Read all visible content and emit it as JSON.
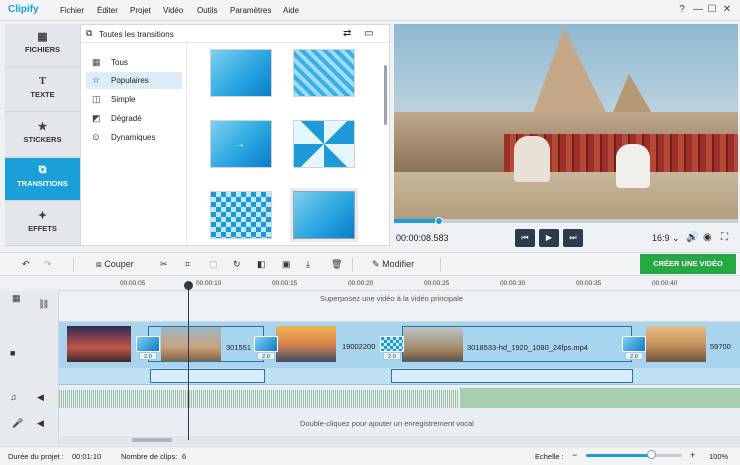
{
  "app": {
    "logo": "Clipify"
  },
  "menu": [
    "Fichier",
    "Éditer",
    "Projet",
    "Vidéo",
    "Outils",
    "Paramètres",
    "Aide"
  ],
  "window_icons": [
    "?",
    "—",
    "☐",
    "✕"
  ],
  "left_tabs": [
    {
      "label": "FICHIERS",
      "icon": "film-icon"
    },
    {
      "label": "TEXTE",
      "icon": "text-icon"
    },
    {
      "label": "STICKERS",
      "icon": "star-icon"
    },
    {
      "label": "TRANSITIONS",
      "icon": "transitions-icon"
    },
    {
      "label": "EFFETS",
      "icon": "wand-icon"
    }
  ],
  "transitions": {
    "title": "Toutes les transitions",
    "categories": [
      {
        "label": "Tous",
        "icon": "grid-icon"
      },
      {
        "label": "Populaires",
        "icon": "star-icon"
      },
      {
        "label": "Simple",
        "icon": "simple-icon"
      },
      {
        "label": "Dégradé",
        "icon": "gradient-icon"
      },
      {
        "label": "Dynamiques",
        "icon": "play-icon"
      }
    ],
    "selected_category": "Populaires"
  },
  "preview": {
    "timecode": "00:00:08.583",
    "progress": 0.13,
    "ratio": "16:9"
  },
  "toolbar": {
    "cut_label": "Couper",
    "edit_label": "Modifier",
    "create_label": "CRÉER UNE VIDÉO"
  },
  "ruler": [
    "00:00:05",
    "00:00:10",
    "00:00:15",
    "00:00:20",
    "00:00:25",
    "00:00:30",
    "00:00:35",
    "00:00:40"
  ],
  "tracks": {
    "overlay_hint": "Superposez une vidéo à la vidéo principale",
    "voice_hint": "Double-cliquez pour ajouter un enregistrement vocal",
    "clips": [
      {
        "label": "",
        "dur": ""
      },
      {
        "label": "301551",
        "dur": "2.0"
      },
      {
        "label": "19002200",
        "dur": "2.0"
      },
      {
        "label": "3018533-hd_1920_1080_24fps.mp4",
        "dur": "2.0"
      },
      {
        "label": "59700",
        "dur": "2.0"
      }
    ]
  },
  "status": {
    "duration_label": "Durée du projet :",
    "duration_value": "00:01:10",
    "clips_label": "Nombre de clips:",
    "clips_value": "6",
    "scale_label": "Echelle :",
    "zoom_minus": "−",
    "zoom_plus": "+",
    "zoom_value": "100%",
    "zoom_level": 0.68
  }
}
